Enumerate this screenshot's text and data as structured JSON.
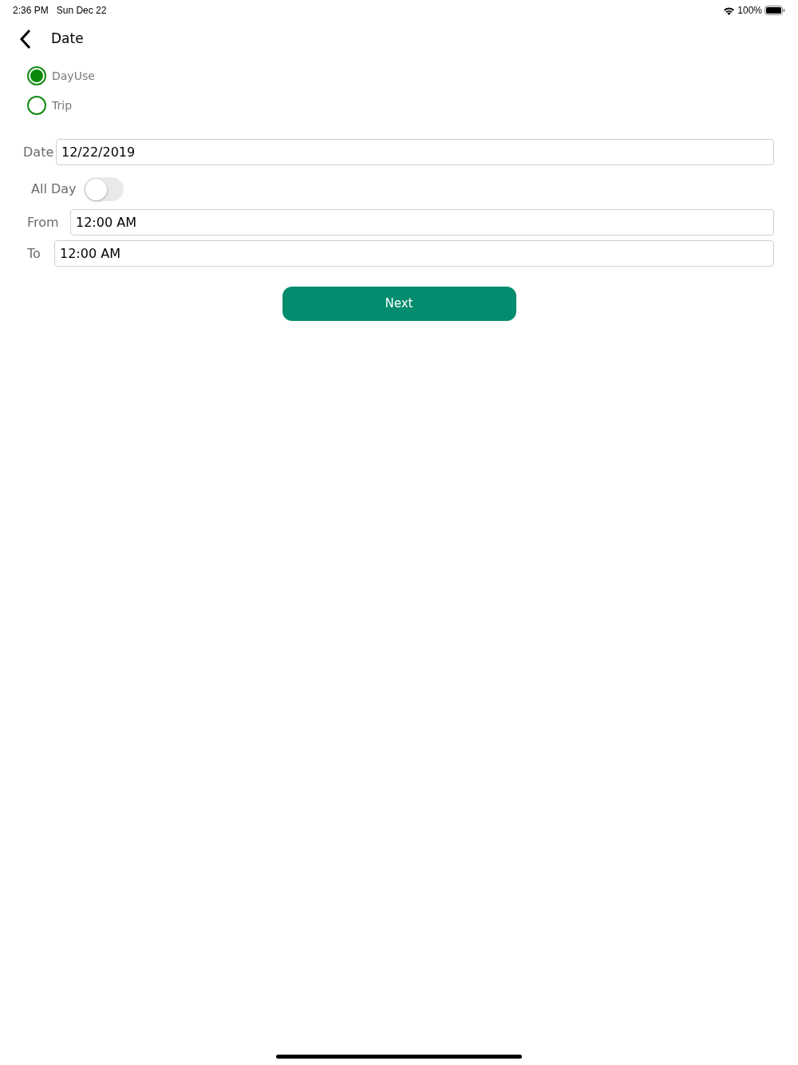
{
  "status_bar": {
    "time": "2:36 PM",
    "date": "Sun Dec 22",
    "battery": "100%"
  },
  "header": {
    "title": "Date"
  },
  "trip_types": [
    {
      "label": "DayUse",
      "selected": true
    },
    {
      "label": "Trip",
      "selected": false
    }
  ],
  "date_field": {
    "label": "Date",
    "value": "12/22/2019"
  },
  "all_day": {
    "label": "All Day",
    "on": false
  },
  "from_field": {
    "label": "From",
    "value": "12:00 AM"
  },
  "to_field": {
    "label": "To",
    "value": "12:00 AM"
  },
  "next_button": {
    "label": "Next"
  }
}
